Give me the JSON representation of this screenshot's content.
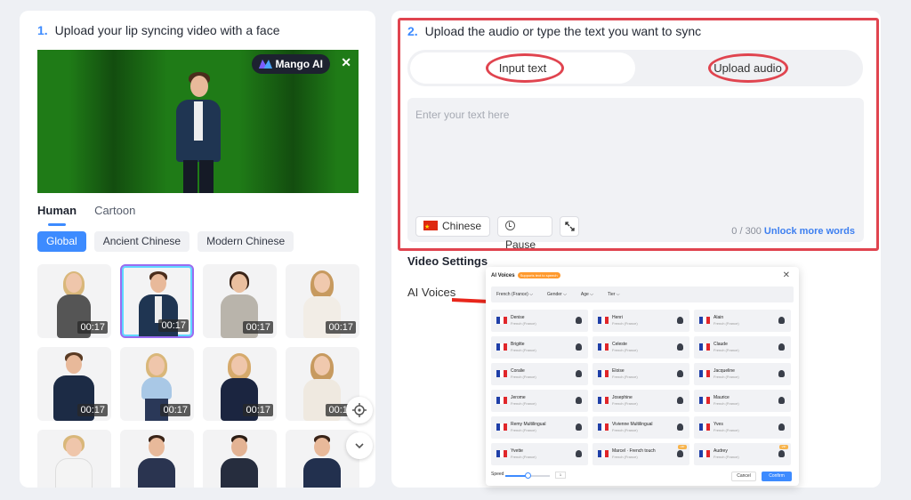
{
  "left": {
    "step_number": "1.",
    "step_title": "Upload your lip syncing video with a face",
    "brand": "Mango AI",
    "close": "✕",
    "tabs": [
      "Human",
      "Cartoon"
    ],
    "chips": [
      "Global",
      "Ancient Chinese",
      "Modern Chinese"
    ],
    "avatars": [
      {
        "duration": "00:17",
        "selected": false
      },
      {
        "duration": "00:17",
        "selected": true
      },
      {
        "duration": "00:17",
        "selected": false
      },
      {
        "duration": "00:17",
        "selected": false
      },
      {
        "duration": "00:17",
        "selected": false
      },
      {
        "duration": "00:17",
        "selected": false
      },
      {
        "duration": "00:17",
        "selected": false
      },
      {
        "duration": "00:17",
        "selected": false
      }
    ]
  },
  "right": {
    "step_number": "2.",
    "step_title": "Upload the audio or type the text you want to sync",
    "mode_input": "Input text",
    "mode_upload": "Upload audio",
    "placeholder": "Enter your text here",
    "language": "Chinese",
    "pause": "Pause",
    "counter": "0 / 300",
    "unlock": "Unlock more words",
    "video_settings": "Video Settings",
    "ai_voices": "AI Voices"
  },
  "modal": {
    "title": "AI Voices",
    "badge": "Supports text to speech",
    "close": "✕",
    "filters": [
      "French (France) ⌵",
      "Gender ⌵",
      "Age ⌵",
      "Tier ⌵"
    ],
    "voices": [
      {
        "name": "Denise",
        "lang": "French (France)"
      },
      {
        "name": "Henri",
        "lang": "French (France)"
      },
      {
        "name": "Alain",
        "lang": "French (France)"
      },
      {
        "name": "Brigitte",
        "lang": "French (France)"
      },
      {
        "name": "Celeste",
        "lang": "French (France)"
      },
      {
        "name": "Claude",
        "lang": "French (France)"
      },
      {
        "name": "Coralie",
        "lang": "French (France)"
      },
      {
        "name": "Eloise",
        "lang": "French (France)"
      },
      {
        "name": "Jacqueline",
        "lang": "French (France)"
      },
      {
        "name": "Jerome",
        "lang": "French (France)"
      },
      {
        "name": "Josephine",
        "lang": "French (France)"
      },
      {
        "name": "Maurice",
        "lang": "French (France)"
      },
      {
        "name": "Remy Multilingual",
        "lang": "French (France)"
      },
      {
        "name": "Vivienne Multilingual",
        "lang": "French (France)"
      },
      {
        "name": "Yves",
        "lang": "French (France)"
      },
      {
        "name": "Yvette",
        "lang": "French (France)"
      },
      {
        "name": "Marcel · French touch",
        "lang": "French (France)"
      },
      {
        "name": "Audrey",
        "lang": "French (France)"
      }
    ],
    "vip": "VIP",
    "speed_label": "Speed",
    "speed_value": "1",
    "speed_fraction": 0.5,
    "cancel": "Cancel",
    "confirm": "Confirm"
  }
}
